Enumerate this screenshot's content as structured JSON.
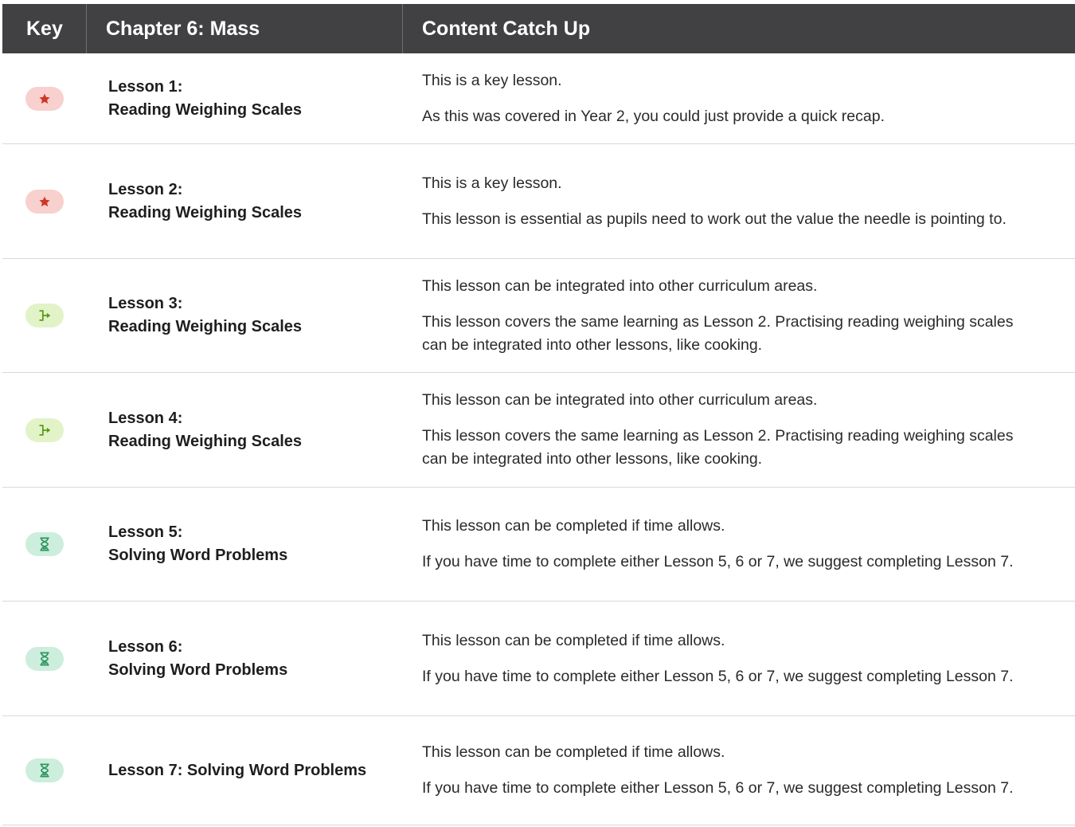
{
  "header": {
    "key": "Key",
    "chapter": "Chapter 6: Mass",
    "content": "Content Catch Up"
  },
  "colors": {
    "key_badge_bg": "#f8d0cd",
    "key_icon": "#cf3626",
    "integrate_badge_bg": "#e2f3c8",
    "integrate_icon": "#5a9a1c",
    "time_badge_bg": "#cdeedd",
    "time_icon": "#2e9461"
  },
  "rows": [
    {
      "icon": "star-icon",
      "lesson_line1": "Lesson 1:",
      "lesson_line2": "Reading Weighing Scales",
      "content1": "This is a key lesson.",
      "content2": "As this was covered in Year 2, you could just provide a quick recap."
    },
    {
      "icon": "star-icon",
      "lesson_line1": "Lesson 2:",
      "lesson_line2": "Reading Weighing Scales",
      "content1": "This is a key lesson.",
      "content2": "This lesson is essential as pupils need to work out the value the needle is pointing to."
    },
    {
      "icon": "integrate-icon",
      "lesson_line1": "Lesson 3:",
      "lesson_line2": "Reading Weighing Scales",
      "content1": "This lesson can be integrated into other curriculum areas.",
      "content2": "This lesson covers the same learning as Lesson 2. Practising reading weighing scales can be integrated into other lessons, like cooking."
    },
    {
      "icon": "integrate-icon",
      "lesson_line1": "Lesson 4:",
      "lesson_line2": "Reading Weighing Scales",
      "content1": "This lesson can be integrated into other curriculum areas.",
      "content2": "This lesson covers the same learning as Lesson 2. Practising reading weighing scales can be integrated into other lessons, like cooking."
    },
    {
      "icon": "hourglass-icon",
      "lesson_line1": "Lesson 5:",
      "lesson_line2": "Solving Word Problems",
      "content1": "This lesson can be completed if time allows.",
      "content2": "If you have time to complete either Lesson 5, 6 or 7, we suggest completing Lesson 7."
    },
    {
      "icon": "hourglass-icon",
      "lesson_line1": "Lesson 6:",
      "lesson_line2": "Solving Word Problems",
      "content1": "This lesson can be completed if time allows.",
      "content2": "If you have time to complete either Lesson 5, 6 or 7, we suggest completing Lesson 7."
    },
    {
      "icon": "hourglass-icon",
      "lesson_line1": "Lesson 7: Solving Word Problems",
      "lesson_line2": "",
      "content1": "This lesson can be completed if time allows.",
      "content2": "If you have time to complete either Lesson 5, 6 or 7, we suggest completing Lesson 7."
    }
  ]
}
